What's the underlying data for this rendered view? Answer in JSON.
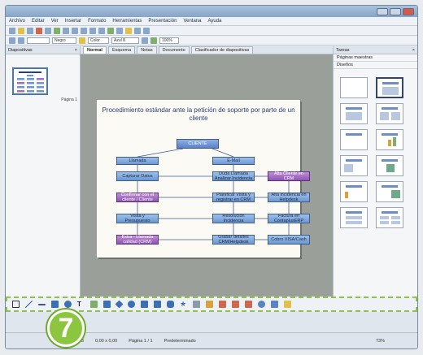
{
  "menu": [
    "Archivo",
    "Editar",
    "Ver",
    "Insertar",
    "Formato",
    "Herramientas",
    "Presentación",
    "Ventana",
    "Ayuda"
  ],
  "toolbar": {
    "color_value": "Negro",
    "area_value": "Color",
    "fill_value": "Azul 8",
    "zoom_value": "100%"
  },
  "left_pane": {
    "title": "Diapositivas",
    "page_label": "Página 1"
  },
  "tabs": [
    "Normal",
    "Esquema",
    "Notas",
    "Documento",
    "Clasificador de diapositivas"
  ],
  "right_pane": {
    "title": "Tareas",
    "sub1": "Páginas maestras",
    "sub2": "Diseños"
  },
  "slide": {
    "title": "Procedimiento estándar ante la petición de soporte por parte de un cliente",
    "boxes": {
      "cliente": "CLIENTE",
      "llamada": "Llamada",
      "email": "E-Mail",
      "captura": "Capturar Datos",
      "duda": "Duda Llamada Analizar Incidencia",
      "alta_cliente": "Alta Cliente en CRM",
      "confirmar": "Confirmar con el cliente / Cliente",
      "planificar": "Planificar Visita y registrar en CRM",
      "alta_incidencia": "Alta incidencia en Helpdesk",
      "visita": "Visita y Presupuesto",
      "resolucion": "Resolución Incidencia",
      "factura": "Factura en ContaplusERP",
      "extra": "Extra - Llamada calidad (CRM)",
      "grabar": "Grabar detalles CRM/Helpdesk",
      "cobro": "Cobro VISA/Cash"
    }
  },
  "status": {
    "position": "1,83 / 4,93",
    "size": "0,00 x 0,00",
    "page": "Página 1 / 1",
    "layout": "Predeterminado",
    "zoom": "73%"
  },
  "step_badge": "7",
  "colors": {
    "highlight": "#8cc63f",
    "canvas": "#9b9f9a",
    "box_blue": "#7fa6dc",
    "box_purple": "#a46ec4"
  }
}
